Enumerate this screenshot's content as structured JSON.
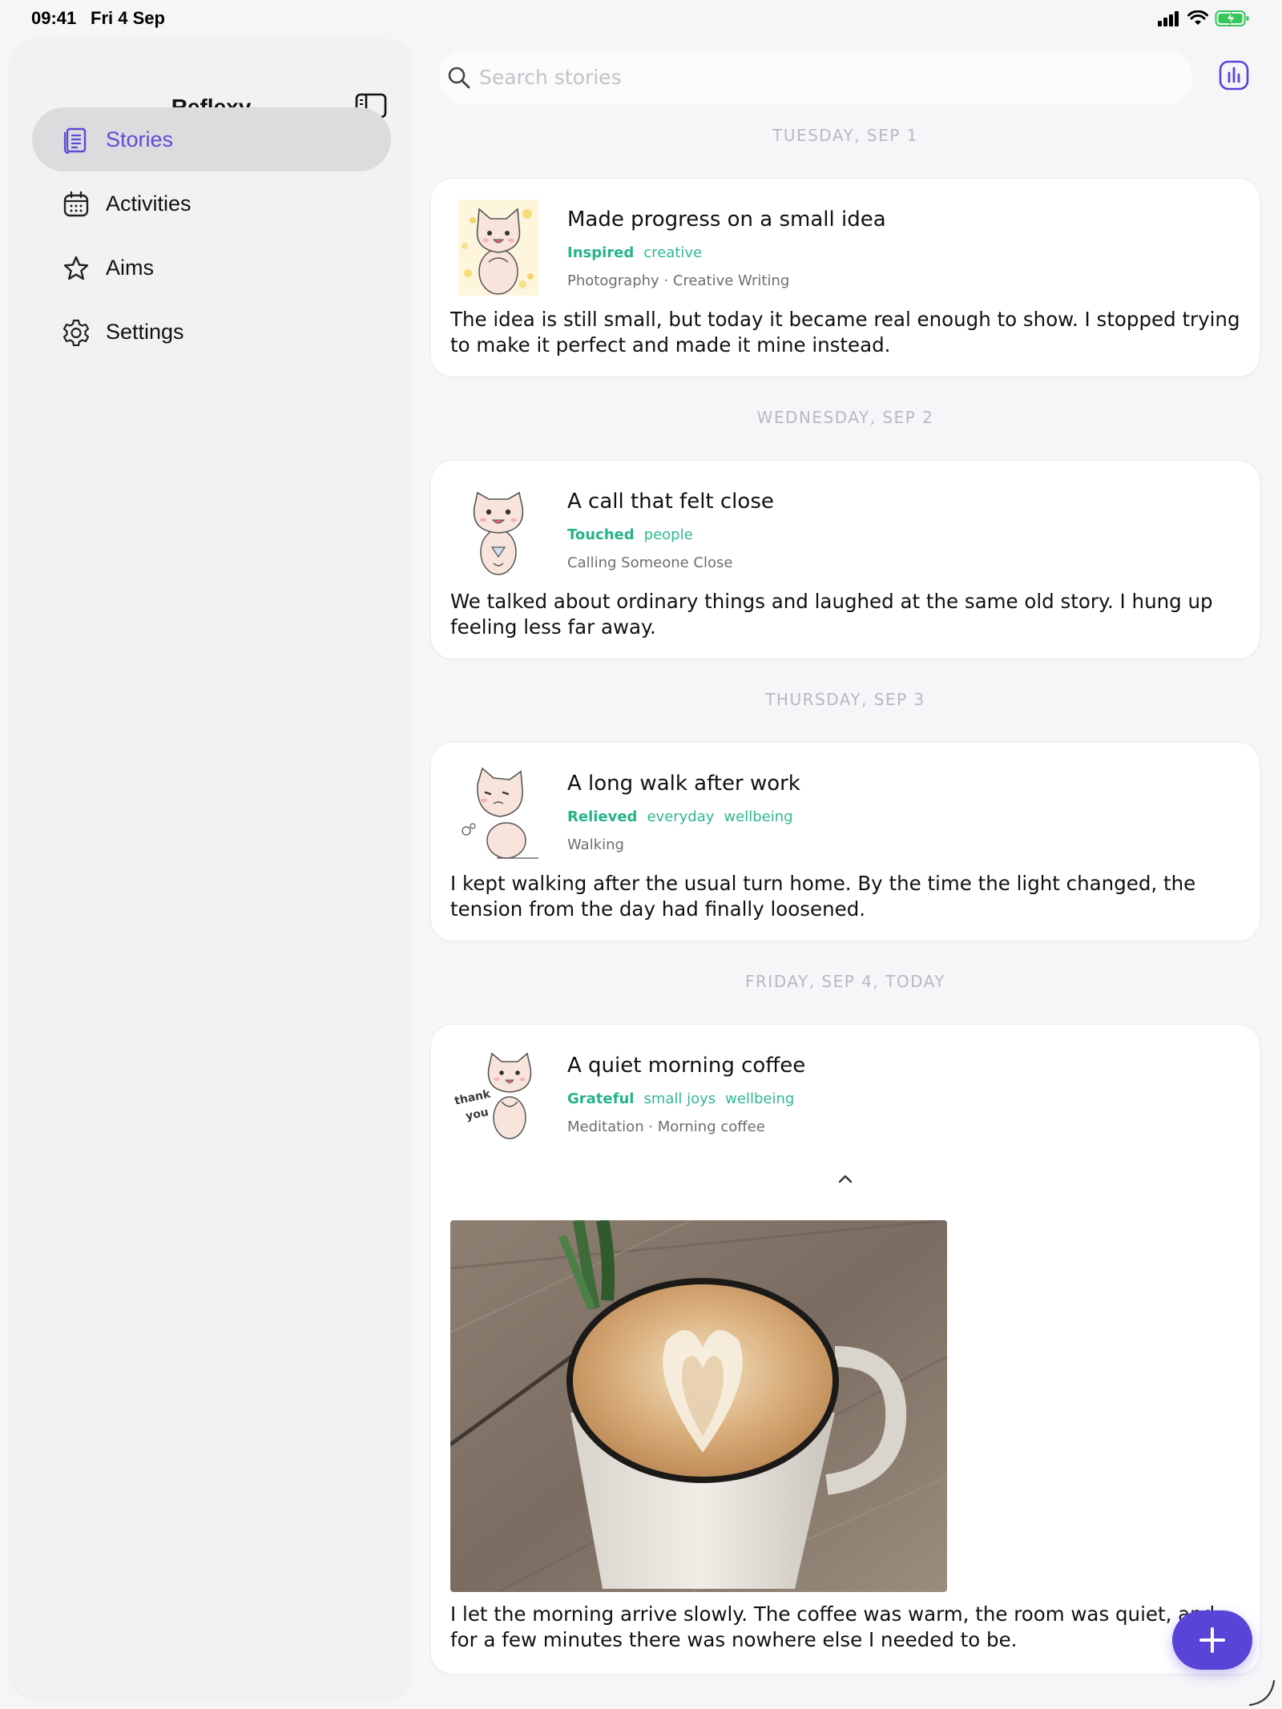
{
  "status_bar": {
    "time": "09:41",
    "date": "Fri 4 Sep"
  },
  "sidebar": {
    "title": "Reflexy",
    "items": [
      {
        "label": "Stories",
        "icon": "stories-icon",
        "active": true
      },
      {
        "label": "Activities",
        "icon": "calendar-icon",
        "active": false
      },
      {
        "label": "Aims",
        "icon": "star-icon",
        "active": false
      },
      {
        "label": "Settings",
        "icon": "gear-icon",
        "active": false
      }
    ]
  },
  "search": {
    "placeholder": "Search stories",
    "value": ""
  },
  "stories": [
    {
      "date": "TUESDAY, SEP 1",
      "title": "Made progress on a small idea",
      "mood": "Inspired",
      "tags": [
        "creative"
      ],
      "activities": "Photography · Creative Writing",
      "body": "The idea is still small, but today it became real enough to show. I stopped trying to make it perfect and made it mine instead."
    },
    {
      "date": "WEDNESDAY, SEP 2",
      "title": "A call that felt close",
      "mood": "Touched",
      "tags": [
        "people"
      ],
      "activities": "Calling Someone Close",
      "body": "We talked about ordinary things and laughed at the same old story. I hung up feeling less far away."
    },
    {
      "date": "THURSDAY, SEP 3",
      "title": "A long walk after work",
      "mood": "Relieved",
      "tags": [
        "everyday",
        "wellbeing"
      ],
      "activities": "Walking",
      "body": "I kept walking after the usual turn home. By the time the light changed, the tension from the day had finally loosened."
    },
    {
      "date": "FRIDAY, SEP 4, TODAY",
      "title": "A quiet morning coffee",
      "mood": "Grateful",
      "tags": [
        "small joys",
        "wellbeing"
      ],
      "activities": "Meditation · Morning coffee",
      "avatar_text_1": "thank",
      "avatar_text_2": "you",
      "body": "I let the morning arrive slowly. The coffee was warm, the room was quiet, and for a few minutes there was nowhere else I needed to be."
    }
  ],
  "colors": {
    "accent": "#5845d8",
    "tag": "#2fb893",
    "date_header": "#b8b8c6"
  }
}
